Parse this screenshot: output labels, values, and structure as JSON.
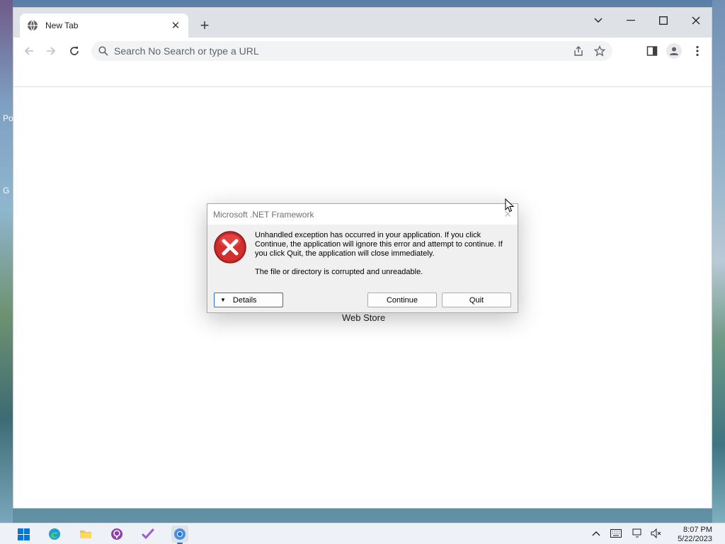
{
  "desktop": {
    "icon_label_1": "Po",
    "icon_label_2": "G"
  },
  "browser": {
    "tab": {
      "title": "New Tab"
    },
    "omnibox": {
      "placeholder": "Search No Search or type a URL"
    },
    "content": {
      "web_store_label": "Web Store"
    }
  },
  "dialog": {
    "title": "Microsoft .NET Framework",
    "message": "Unhandled exception has occurred in your application. If you click Continue, the application will ignore this error and attempt to continue. If you click Quit, the application will close immediately.",
    "detail": "The file or directory is corrupted and unreadable.",
    "buttons": {
      "details": "Details",
      "continue": "Continue",
      "quit": "Quit"
    }
  },
  "taskbar": {
    "time": "8:07 PM",
    "date": "5/22/2023"
  },
  "colors": {
    "error_red": "#d32f2f",
    "accent_blue": "#2b6bd6",
    "chrome_tabbar": "#dee1e6"
  }
}
